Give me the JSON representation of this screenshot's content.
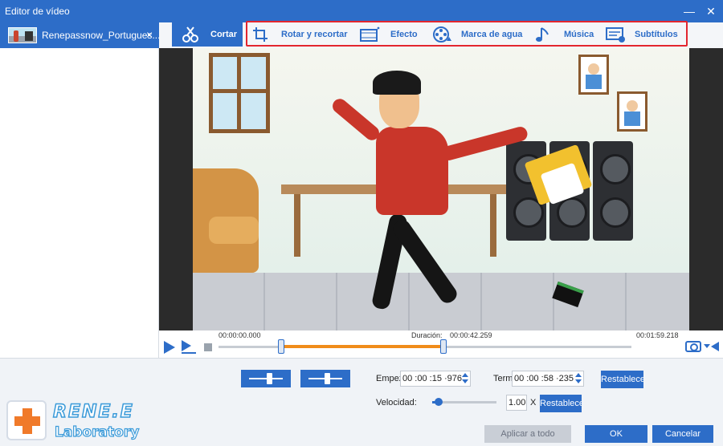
{
  "window": {
    "title": "Editor de vídeo",
    "minimize_icon": "minimize-icon",
    "close_icon": "close-icon"
  },
  "file_tab": {
    "name": "Renepassnow_Portugues...",
    "close": "×"
  },
  "toolbar": {
    "items": [
      {
        "label": "Cortar",
        "icon": "scissors-icon",
        "active": true
      },
      {
        "label": "Rotar y recortar",
        "icon": "crop-rotate-icon",
        "active": false
      },
      {
        "label": "Efecto",
        "icon": "effect-film-icon",
        "active": false
      },
      {
        "label": "Marca de agua",
        "icon": "watermark-reel-icon",
        "active": false
      },
      {
        "label": "Música",
        "icon": "music-note-icon",
        "active": false
      },
      {
        "label": "Subtítulos",
        "icon": "subtitle-icon",
        "active": false
      }
    ],
    "highlight_color": "#e3262f"
  },
  "timeline": {
    "start_time": "00:00:00.000",
    "duration_label": "Duración:",
    "duration": "00:00:42.259",
    "end_time": "00:01:59.218",
    "selection_start": 0.152,
    "selection_end": 0.545
  },
  "controls": {
    "start_label": "Empez",
    "start_value": "00 :00 :15 ·976",
    "end_label": "Termi",
    "end_value": "00 :00 :58 ·235",
    "reset_label": "Restablecer",
    "speed_label": "Velocidad:",
    "speed_value": "1.00",
    "speed_unit": "X",
    "speed_reset_label": "Restablecer",
    "speed_level": 0.1
  },
  "footer": {
    "apply_all": "Aplicar a todo",
    "ok": "OK",
    "cancel": "Cancelar"
  },
  "logo": {
    "line1": "RENE.E",
    "line2": "Laboratory"
  },
  "colors": {
    "accent": "#2d6dc8",
    "selection": "#f08c1a",
    "logo_orange": "#f07a2a"
  }
}
